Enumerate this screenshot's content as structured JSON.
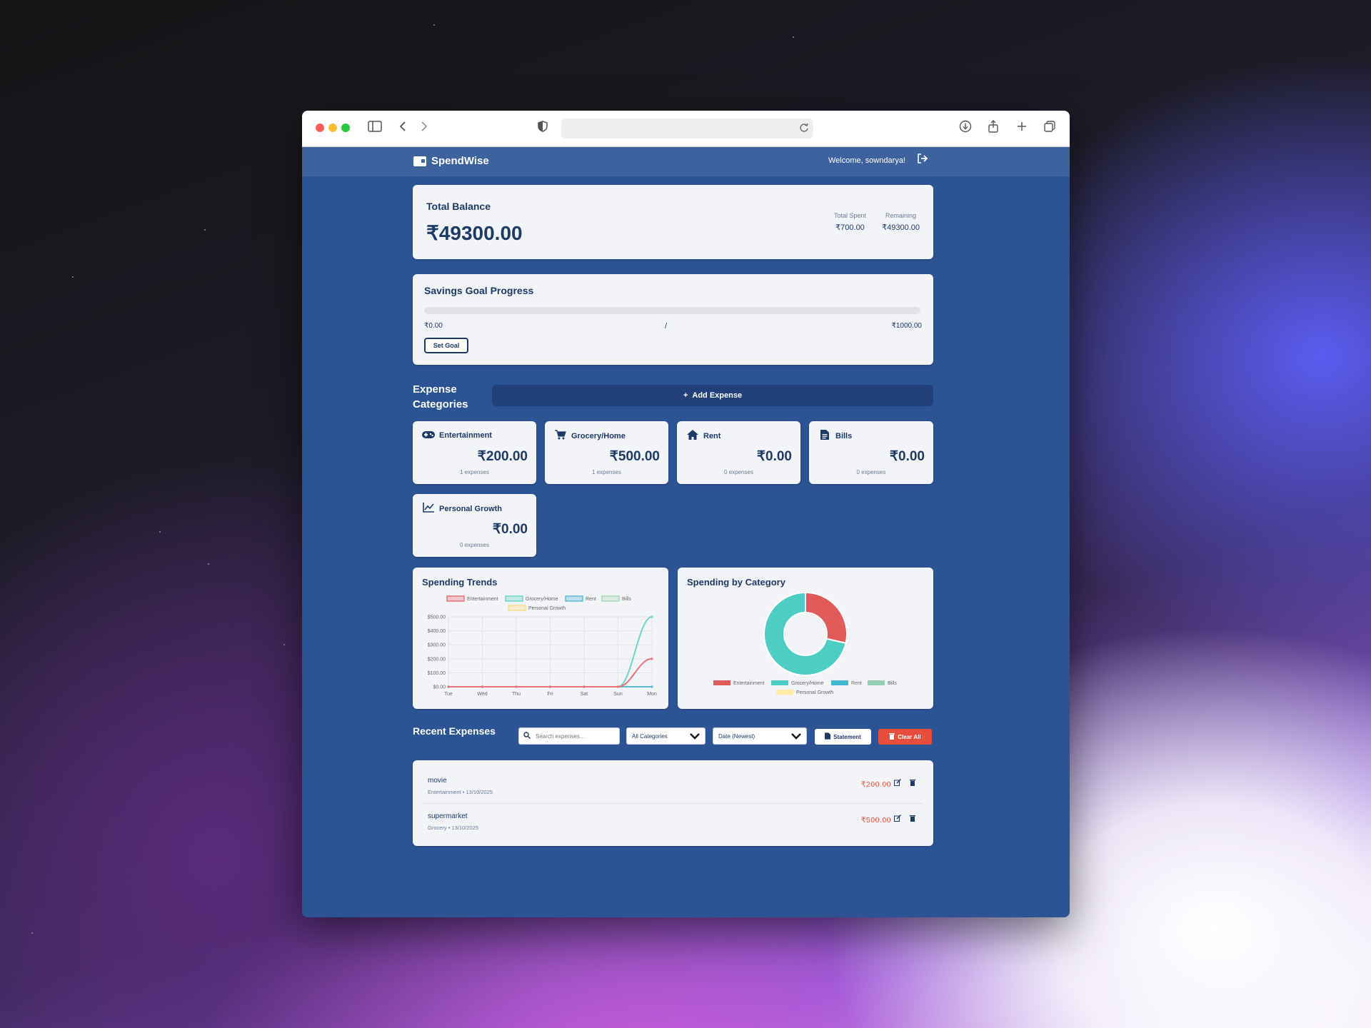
{
  "app": {
    "brand": "SpendWise",
    "welcome": "Welcome, sowndarya!"
  },
  "balance": {
    "label": "Total Balance",
    "amount": "₹49300.00",
    "spent_label": "Total Spent",
    "spent_value": "₹700.00",
    "remaining_label": "Remaining",
    "remaining_value": "₹49300.00"
  },
  "savings": {
    "title": "Savings Goal Progress",
    "current": "₹0.00",
    "separator": "/",
    "goal": "₹1000.00",
    "progress": 0,
    "button": "Set Goal"
  },
  "categories_section": {
    "title": "Expense Categories",
    "add_button": "Add Expense",
    "items": [
      {
        "name": "Entertainment",
        "amount": "₹200.00",
        "count": "1 expenses",
        "icon": "gamepad-icon"
      },
      {
        "name": "Grocery/Home",
        "amount": "₹500.00",
        "count": "1 expenses",
        "icon": "cart-icon"
      },
      {
        "name": "Rent",
        "amount": "₹0.00",
        "count": "0 expenses",
        "icon": "home-icon"
      },
      {
        "name": "Bills",
        "amount": "₹0.00",
        "count": "0 expenses",
        "icon": "document-icon"
      },
      {
        "name": "Personal Growth",
        "amount": "₹0.00",
        "count": "0 expenses",
        "icon": "chart-line-icon"
      }
    ]
  },
  "trends": {
    "title": "Spending Trends"
  },
  "by_category": {
    "title": "Spending by Category"
  },
  "chart_data": [
    {
      "type": "line",
      "title": "Spending Trends",
      "categories": [
        "Tue",
        "Wed",
        "Thu",
        "Fri",
        "Sat",
        "Sun",
        "Mon"
      ],
      "ylim": [
        0,
        500
      ],
      "yticks": [
        "$0.00",
        "$100.00",
        "$200.00",
        "$300.00",
        "$400.00",
        "$500.00"
      ],
      "grid": true,
      "legend": "top",
      "series": [
        {
          "name": "Entertainment",
          "values": [
            0,
            0,
            0,
            0,
            0,
            0,
            200
          ],
          "color": "#e8737a"
        },
        {
          "name": "Grocery/Home",
          "values": [
            0,
            0,
            0,
            0,
            0,
            0,
            500
          ],
          "color": "#6fd3cc"
        },
        {
          "name": "Rent",
          "values": [
            0,
            0,
            0,
            0,
            0,
            0,
            0
          ],
          "color": "#5fb8d8"
        },
        {
          "name": "Bills",
          "values": [
            0,
            0,
            0,
            0,
            0,
            0,
            0
          ],
          "color": "#a8d8b8"
        },
        {
          "name": "Personal Growth",
          "values": [
            0,
            0,
            0,
            0,
            0,
            0,
            0
          ],
          "color": "#f8e08a"
        }
      ]
    },
    {
      "type": "pie",
      "title": "Spending by Category",
      "donut": true,
      "legend": "bottom",
      "labels": [
        "Entertainment",
        "Grocery/Home",
        "Rent",
        "Bills",
        "Personal Growth"
      ],
      "values": [
        200,
        500,
        0,
        0,
        0
      ],
      "colors": [
        "#e05a5a",
        "#4ecdc4",
        "#45b7d1",
        "#96ceb4",
        "#ffeaa7"
      ]
    }
  ],
  "recent": {
    "title": "Recent Expenses",
    "search_placeholder": "Search expenses...",
    "category_filter": "All Categories",
    "sort": "Date (Newest)",
    "statement_button": "Statement",
    "clear_button": "Clear All",
    "rows": [
      {
        "name": "movie",
        "meta": "Entertainment • 13/10/2025",
        "amount": "₹200.00"
      },
      {
        "name": "supermarket",
        "meta": "Grocery • 13/10/2025",
        "amount": "₹500.00"
      }
    ]
  }
}
